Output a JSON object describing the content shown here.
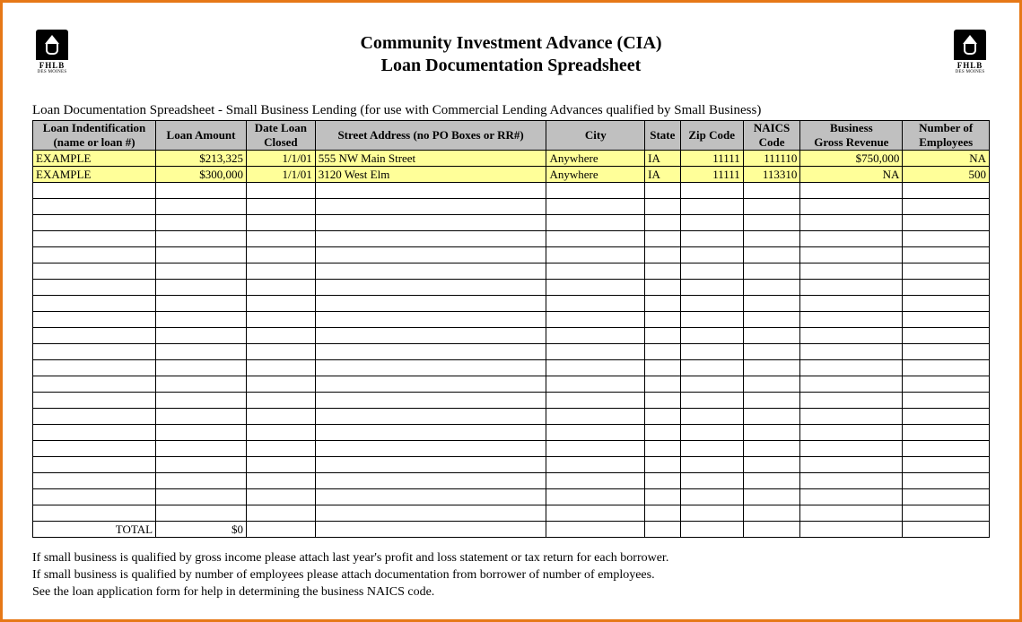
{
  "header": {
    "title1": "Community Investment Advance (CIA)",
    "title2": "Loan Documentation Spreadsheet",
    "logo_text": "FHLB",
    "logo_sub": "DES MOINES"
  },
  "subtitle": "Loan Documentation Spreadsheet - Small Business Lending (for use with Commercial Lending Advances qualified by Small Business)",
  "columns": {
    "loan_id": {
      "line1": "Loan Indentification",
      "line2": "(name or loan #)"
    },
    "amount": {
      "line1": "",
      "line2": "Loan Amount"
    },
    "date": {
      "line1": "Date Loan",
      "line2": "Closed"
    },
    "street": {
      "line1": "",
      "line2": "Street Address (no PO Boxes or RR#)"
    },
    "city": {
      "line1": "",
      "line2": "City"
    },
    "state": {
      "line1": "",
      "line2": "State"
    },
    "zip": {
      "line1": "",
      "line2": "Zip Code"
    },
    "naics": {
      "line1": "NAICS",
      "line2": "Code"
    },
    "revenue": {
      "line1": "Business",
      "line2": "Gross Revenue"
    },
    "employees": {
      "line1": "Number of",
      "line2": "Employees"
    }
  },
  "rows": [
    {
      "loan_id": "EXAMPLE",
      "amount": "$213,325",
      "date": "1/1/01",
      "street": "555 NW Main Street",
      "city": "Anywhere",
      "state": "IA",
      "zip": "11111",
      "naics": "111110",
      "revenue": "$750,000",
      "employees": "NA"
    },
    {
      "loan_id": "EXAMPLE",
      "amount": "$300,000",
      "date": "1/1/01",
      "street": "3120 West Elm",
      "city": "Anywhere",
      "state": "IA",
      "zip": "11111",
      "naics": "113310",
      "revenue": "NA",
      "employees": "500"
    }
  ],
  "empty_rows": 21,
  "total": {
    "label": "TOTAL",
    "amount": "$0"
  },
  "footer": {
    "line1": "If small business is qualified by gross income please attach last year's profit and loss statement or tax return for each borrower.",
    "line2": "If small business is qualified by number of employees please attach documentation from borrower of number of employees.",
    "line3": "See the loan application form for help in determining the business NAICS code."
  }
}
